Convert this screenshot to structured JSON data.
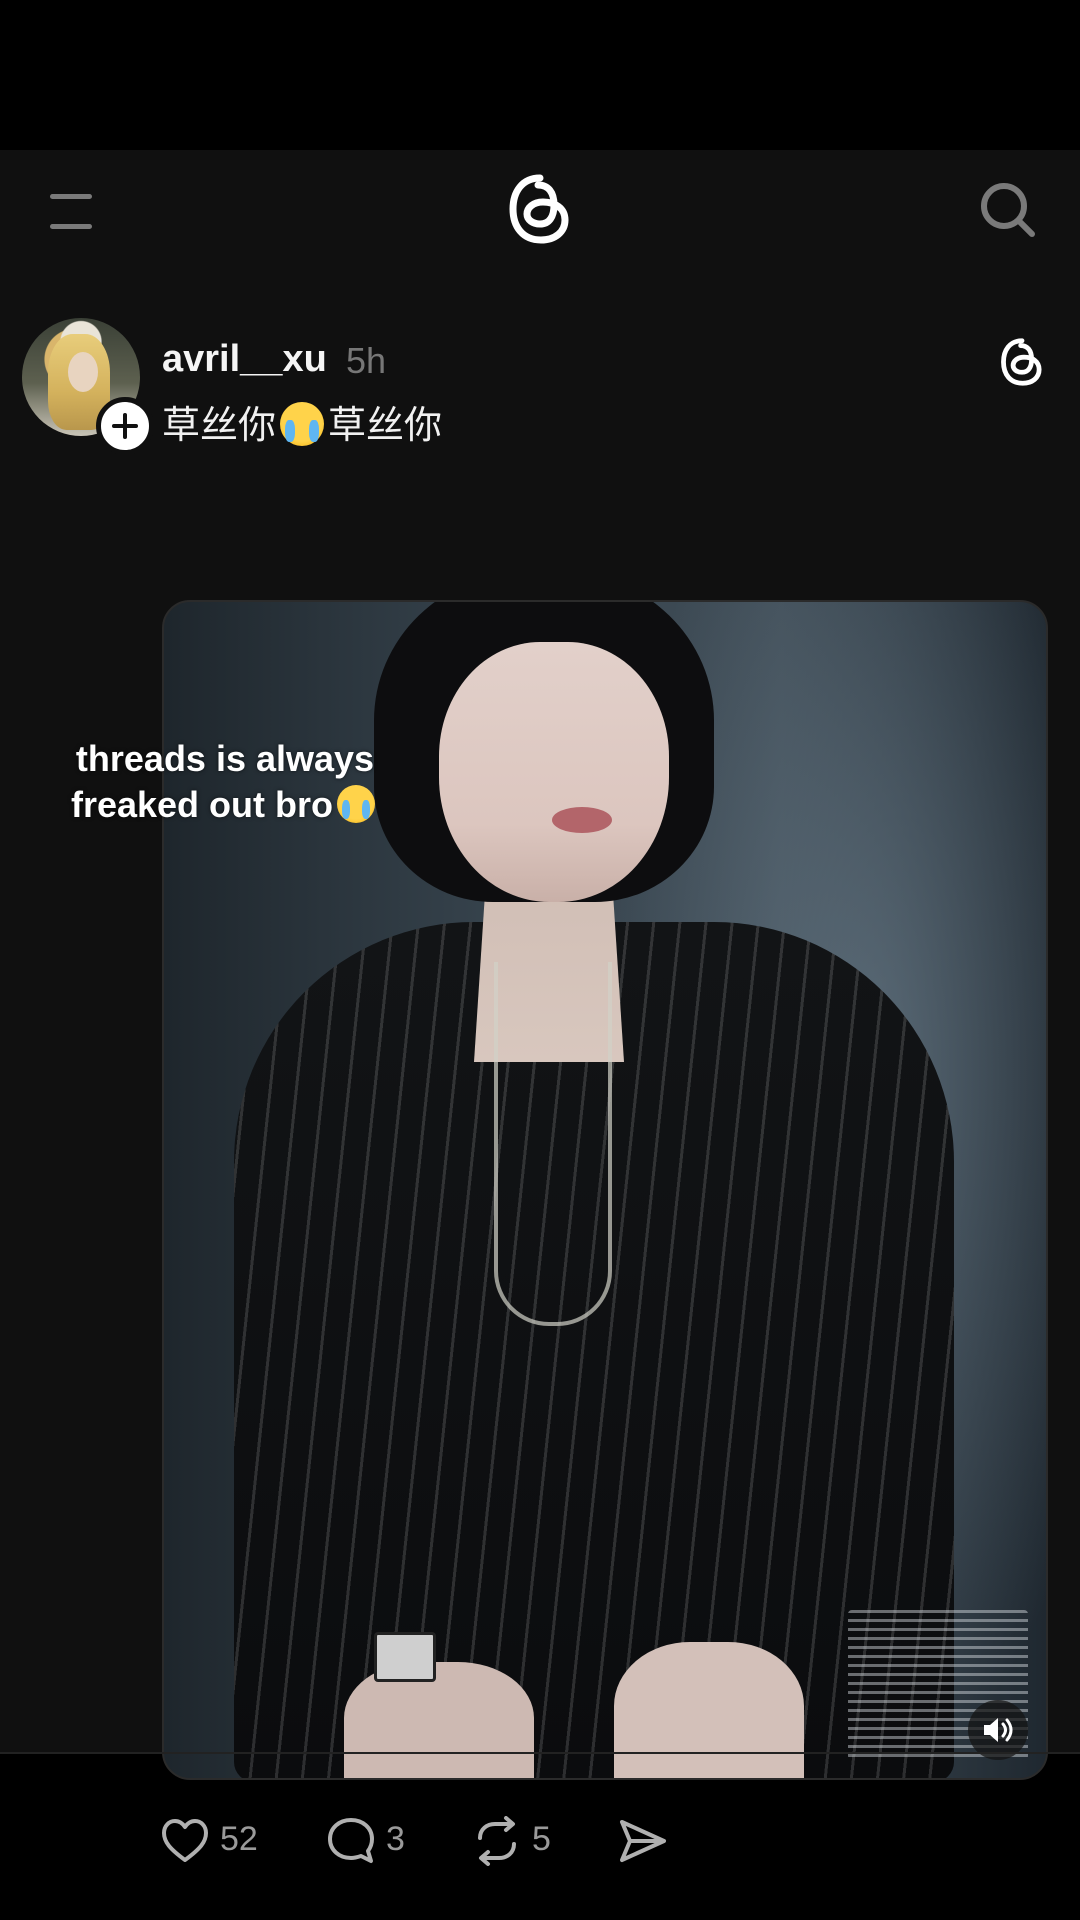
{
  "header": {
    "menu_icon": "menu-icon",
    "logo_icon": "threads-logo-icon",
    "search_icon": "search-icon"
  },
  "post": {
    "username": "avril__xu",
    "timestamp": "5h",
    "caption_part1": "草丝你",
    "caption_part2": "草丝你",
    "caption_emoji": "loudly-crying-face-emoji",
    "follow_icon": "plus-icon",
    "media": {
      "overlay_line1": "threads is always",
      "overlay_line2": "freaked out bro",
      "sound_icon": "speaker-icon"
    },
    "actions": {
      "likes": "52",
      "comments": "3",
      "reposts": "5",
      "like_icon": "heart-icon",
      "comment_icon": "comment-bubble-icon",
      "repost_icon": "repost-icon",
      "share_icon": "send-icon"
    }
  },
  "colors": {
    "background": "#101010",
    "text": "#f3f3f3",
    "muted": "#9a9a9a"
  }
}
